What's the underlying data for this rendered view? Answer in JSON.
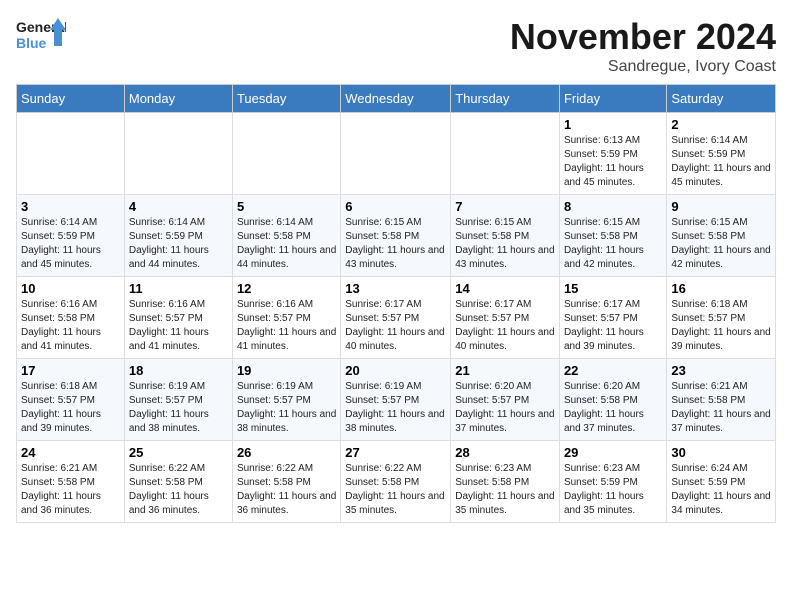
{
  "logo": {
    "line1": "General",
    "line2": "Blue"
  },
  "title": "November 2024",
  "location": "Sandregue, Ivory Coast",
  "weekdays": [
    "Sunday",
    "Monday",
    "Tuesday",
    "Wednesday",
    "Thursday",
    "Friday",
    "Saturday"
  ],
  "weeks": [
    [
      {
        "day": "",
        "info": ""
      },
      {
        "day": "",
        "info": ""
      },
      {
        "day": "",
        "info": ""
      },
      {
        "day": "",
        "info": ""
      },
      {
        "day": "",
        "info": ""
      },
      {
        "day": "1",
        "info": "Sunrise: 6:13 AM\nSunset: 5:59 PM\nDaylight: 11 hours and 45 minutes."
      },
      {
        "day": "2",
        "info": "Sunrise: 6:14 AM\nSunset: 5:59 PM\nDaylight: 11 hours and 45 minutes."
      }
    ],
    [
      {
        "day": "3",
        "info": "Sunrise: 6:14 AM\nSunset: 5:59 PM\nDaylight: 11 hours and 45 minutes."
      },
      {
        "day": "4",
        "info": "Sunrise: 6:14 AM\nSunset: 5:59 PM\nDaylight: 11 hours and 44 minutes."
      },
      {
        "day": "5",
        "info": "Sunrise: 6:14 AM\nSunset: 5:58 PM\nDaylight: 11 hours and 44 minutes."
      },
      {
        "day": "6",
        "info": "Sunrise: 6:15 AM\nSunset: 5:58 PM\nDaylight: 11 hours and 43 minutes."
      },
      {
        "day": "7",
        "info": "Sunrise: 6:15 AM\nSunset: 5:58 PM\nDaylight: 11 hours and 43 minutes."
      },
      {
        "day": "8",
        "info": "Sunrise: 6:15 AM\nSunset: 5:58 PM\nDaylight: 11 hours and 42 minutes."
      },
      {
        "day": "9",
        "info": "Sunrise: 6:15 AM\nSunset: 5:58 PM\nDaylight: 11 hours and 42 minutes."
      }
    ],
    [
      {
        "day": "10",
        "info": "Sunrise: 6:16 AM\nSunset: 5:58 PM\nDaylight: 11 hours and 41 minutes."
      },
      {
        "day": "11",
        "info": "Sunrise: 6:16 AM\nSunset: 5:57 PM\nDaylight: 11 hours and 41 minutes."
      },
      {
        "day": "12",
        "info": "Sunrise: 6:16 AM\nSunset: 5:57 PM\nDaylight: 11 hours and 41 minutes."
      },
      {
        "day": "13",
        "info": "Sunrise: 6:17 AM\nSunset: 5:57 PM\nDaylight: 11 hours and 40 minutes."
      },
      {
        "day": "14",
        "info": "Sunrise: 6:17 AM\nSunset: 5:57 PM\nDaylight: 11 hours and 40 minutes."
      },
      {
        "day": "15",
        "info": "Sunrise: 6:17 AM\nSunset: 5:57 PM\nDaylight: 11 hours and 39 minutes."
      },
      {
        "day": "16",
        "info": "Sunrise: 6:18 AM\nSunset: 5:57 PM\nDaylight: 11 hours and 39 minutes."
      }
    ],
    [
      {
        "day": "17",
        "info": "Sunrise: 6:18 AM\nSunset: 5:57 PM\nDaylight: 11 hours and 39 minutes."
      },
      {
        "day": "18",
        "info": "Sunrise: 6:19 AM\nSunset: 5:57 PM\nDaylight: 11 hours and 38 minutes."
      },
      {
        "day": "19",
        "info": "Sunrise: 6:19 AM\nSunset: 5:57 PM\nDaylight: 11 hours and 38 minutes."
      },
      {
        "day": "20",
        "info": "Sunrise: 6:19 AM\nSunset: 5:57 PM\nDaylight: 11 hours and 38 minutes."
      },
      {
        "day": "21",
        "info": "Sunrise: 6:20 AM\nSunset: 5:57 PM\nDaylight: 11 hours and 37 minutes."
      },
      {
        "day": "22",
        "info": "Sunrise: 6:20 AM\nSunset: 5:58 PM\nDaylight: 11 hours and 37 minutes."
      },
      {
        "day": "23",
        "info": "Sunrise: 6:21 AM\nSunset: 5:58 PM\nDaylight: 11 hours and 37 minutes."
      }
    ],
    [
      {
        "day": "24",
        "info": "Sunrise: 6:21 AM\nSunset: 5:58 PM\nDaylight: 11 hours and 36 minutes."
      },
      {
        "day": "25",
        "info": "Sunrise: 6:22 AM\nSunset: 5:58 PM\nDaylight: 11 hours and 36 minutes."
      },
      {
        "day": "26",
        "info": "Sunrise: 6:22 AM\nSunset: 5:58 PM\nDaylight: 11 hours and 36 minutes."
      },
      {
        "day": "27",
        "info": "Sunrise: 6:22 AM\nSunset: 5:58 PM\nDaylight: 11 hours and 35 minutes."
      },
      {
        "day": "28",
        "info": "Sunrise: 6:23 AM\nSunset: 5:58 PM\nDaylight: 11 hours and 35 minutes."
      },
      {
        "day": "29",
        "info": "Sunrise: 6:23 AM\nSunset: 5:59 PM\nDaylight: 11 hours and 35 minutes."
      },
      {
        "day": "30",
        "info": "Sunrise: 6:24 AM\nSunset: 5:59 PM\nDaylight: 11 hours and 34 minutes."
      }
    ]
  ]
}
